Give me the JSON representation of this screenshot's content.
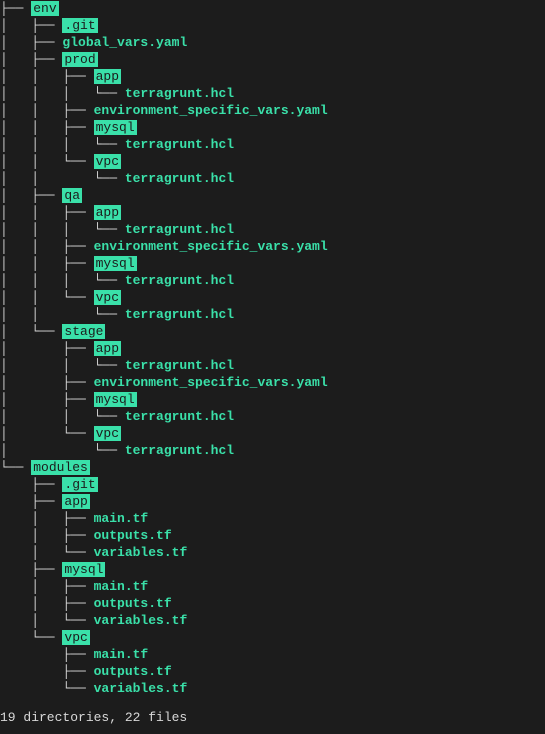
{
  "lines": [
    {
      "connector": "├── ",
      "type": "dir",
      "text": "env"
    },
    {
      "connector": "│   ├── ",
      "type": "dir",
      "text": ".git"
    },
    {
      "connector": "│   ├── ",
      "type": "file",
      "text": "global_vars.yaml"
    },
    {
      "connector": "│   ├── ",
      "type": "dir",
      "text": "prod"
    },
    {
      "connector": "│   │   ├── ",
      "type": "dir",
      "text": "app"
    },
    {
      "connector": "│   │   │   └── ",
      "type": "file",
      "text": "terragrunt.hcl"
    },
    {
      "connector": "│   │   ├── ",
      "type": "file",
      "text": "environment_specific_vars.yaml"
    },
    {
      "connector": "│   │   ├── ",
      "type": "dir",
      "text": "mysql"
    },
    {
      "connector": "│   │   │   └── ",
      "type": "file",
      "text": "terragrunt.hcl"
    },
    {
      "connector": "│   │   └── ",
      "type": "dir",
      "text": "vpc"
    },
    {
      "connector": "│   │       └── ",
      "type": "file",
      "text": "terragrunt.hcl"
    },
    {
      "connector": "│   ├── ",
      "type": "dir",
      "text": "qa"
    },
    {
      "connector": "│   │   ├── ",
      "type": "dir",
      "text": "app"
    },
    {
      "connector": "│   │   │   └── ",
      "type": "file",
      "text": "terragrunt.hcl"
    },
    {
      "connector": "│   │   ├── ",
      "type": "file",
      "text": "environment_specific_vars.yaml"
    },
    {
      "connector": "│   │   ├── ",
      "type": "dir",
      "text": "mysql"
    },
    {
      "connector": "│   │   │   └── ",
      "type": "file",
      "text": "terragrunt.hcl"
    },
    {
      "connector": "│   │   └── ",
      "type": "dir",
      "text": "vpc"
    },
    {
      "connector": "│   │       └── ",
      "type": "file",
      "text": "terragrunt.hcl"
    },
    {
      "connector": "│   └── ",
      "type": "dir",
      "text": "stage"
    },
    {
      "connector": "│       ├── ",
      "type": "dir",
      "text": "app"
    },
    {
      "connector": "│       │   └── ",
      "type": "file",
      "text": "terragrunt.hcl"
    },
    {
      "connector": "│       ├── ",
      "type": "file",
      "text": "environment_specific_vars.yaml"
    },
    {
      "connector": "│       ├── ",
      "type": "dir",
      "text": "mysql"
    },
    {
      "connector": "│       │   └── ",
      "type": "file",
      "text": "terragrunt.hcl"
    },
    {
      "connector": "│       └── ",
      "type": "dir",
      "text": "vpc"
    },
    {
      "connector": "│           └── ",
      "type": "file",
      "text": "terragrunt.hcl"
    },
    {
      "connector": "└── ",
      "type": "dir",
      "text": "modules"
    },
    {
      "connector": "    ├── ",
      "type": "dir",
      "text": ".git"
    },
    {
      "connector": "    ├── ",
      "type": "dir",
      "text": "app"
    },
    {
      "connector": "    │   ├── ",
      "type": "file",
      "text": "main.tf"
    },
    {
      "connector": "    │   ├── ",
      "type": "file",
      "text": "outputs.tf"
    },
    {
      "connector": "    │   └── ",
      "type": "file",
      "text": "variables.tf"
    },
    {
      "connector": "    ├── ",
      "type": "dir",
      "text": "mysql"
    },
    {
      "connector": "    │   ├── ",
      "type": "file",
      "text": "main.tf"
    },
    {
      "connector": "    │   ├── ",
      "type": "file",
      "text": "outputs.tf"
    },
    {
      "connector": "    │   └── ",
      "type": "file",
      "text": "variables.tf"
    },
    {
      "connector": "    └── ",
      "type": "dir",
      "text": "vpc"
    },
    {
      "connector": "        ├── ",
      "type": "file",
      "text": "main.tf"
    },
    {
      "connector": "        ├── ",
      "type": "file",
      "text": "outputs.tf"
    },
    {
      "connector": "        └── ",
      "type": "file",
      "text": "variables.tf"
    }
  ],
  "summary": "19 directories, 22 files"
}
